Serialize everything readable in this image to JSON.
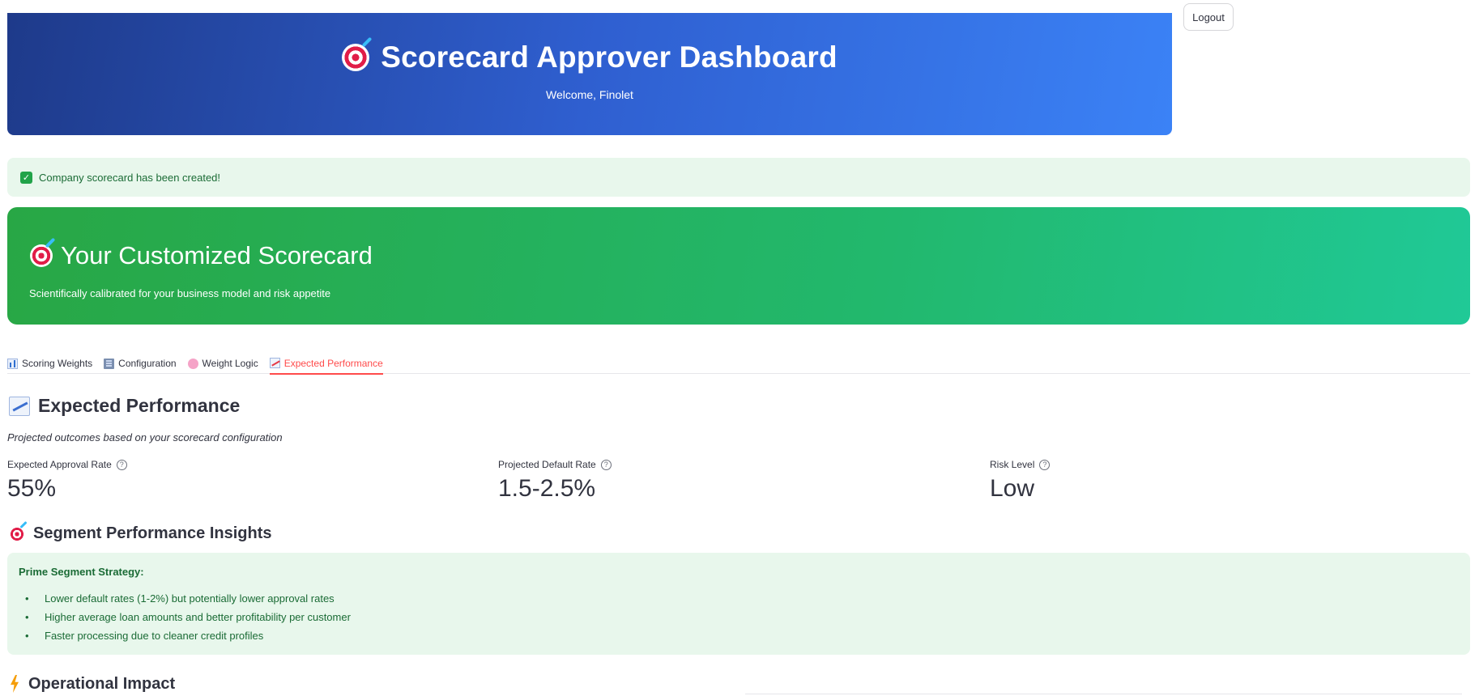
{
  "header": {
    "title": "Scorecard Approver Dashboard",
    "welcome": "Welcome, Finolet",
    "icon": "target-icon",
    "colors": {
      "gradient_start": "#1e3a8a",
      "gradient_end": "#3b82f6"
    }
  },
  "logout_label": "Logout",
  "success_alert": {
    "text": "Company scorecard has been created!",
    "icon": "check-icon"
  },
  "scorecard_banner": {
    "title": "Your Customized Scorecard",
    "subtitle": "Scientifically calibrated for your business model and risk appetite",
    "colors": {
      "gradient_start": "#28a745",
      "gradient_end": "#20c997"
    }
  },
  "tabs": [
    {
      "label": "Scoring Weights",
      "icon": "bar-chart-icon",
      "active": false
    },
    {
      "label": "Configuration",
      "icon": "building-icon",
      "active": false
    },
    {
      "label": "Weight Logic",
      "icon": "brain-icon",
      "active": false
    },
    {
      "label": "Expected Performance",
      "icon": "chart-increasing-icon",
      "active": true
    }
  ],
  "performance": {
    "title": "Expected Performance",
    "caption": "Projected outcomes based on your scorecard configuration",
    "metrics": [
      {
        "label": "Expected Approval Rate",
        "value": "55%"
      },
      {
        "label": "Projected Default Rate",
        "value": "1.5-2.5%"
      },
      {
        "label": "Risk Level",
        "value": "Low"
      }
    ]
  },
  "segment": {
    "title": "Segment Performance Insights",
    "heading": "Prime Segment Strategy:",
    "items": [
      "Lower default rates (1-2%) but potentially lower approval rates",
      "Higher average loan amounts and better profitability per customer",
      "Faster processing due to cleaner credit profiles"
    ]
  },
  "operational": {
    "title": "Operational Impact"
  },
  "colors": {
    "accent": "#ff4b4b",
    "success_bg": "#e8f7ec",
    "success_text": "#1a6b35"
  }
}
